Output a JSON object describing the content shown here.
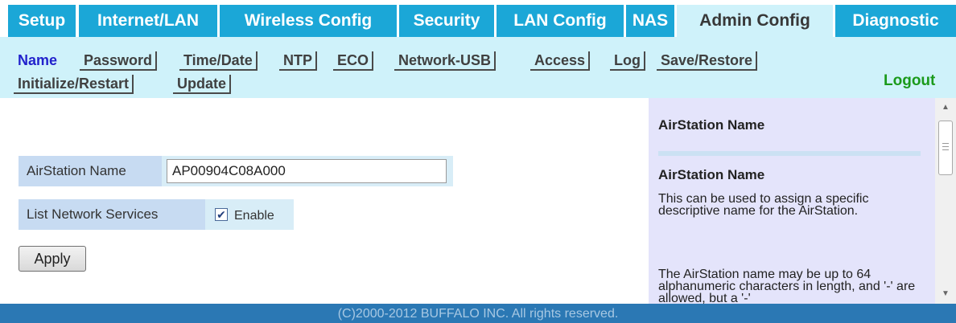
{
  "nav": {
    "tabs": [
      {
        "label": "Setup"
      },
      {
        "label": "Internet/LAN"
      },
      {
        "label": "Wireless Config"
      },
      {
        "label": "Security"
      },
      {
        "label": "LAN Config"
      },
      {
        "label": "NAS"
      },
      {
        "label": "Admin Config",
        "active": true
      },
      {
        "label": "Diagnostic"
      }
    ]
  },
  "subnav": {
    "items": [
      {
        "label": "Name",
        "active": true
      },
      {
        "label": "Password"
      },
      {
        "label": "Time/Date"
      },
      {
        "label": "NTP"
      },
      {
        "label": "ECO"
      },
      {
        "label": "Network-USB"
      },
      {
        "label": "Access"
      },
      {
        "label": "Log"
      },
      {
        "label": "Save/Restore"
      },
      {
        "label": "Initialize/Restart"
      },
      {
        "label": "Update"
      }
    ],
    "logout_label": "Logout"
  },
  "form": {
    "name_label": "AirStation Name",
    "name_value": "AP00904C08A000",
    "services_label": "List Network Services",
    "enable_checked": true,
    "enable_label": "Enable",
    "apply_label": "Apply"
  },
  "help": {
    "title": "AirStation Name",
    "subtitle": "AirStation Name",
    "para1": "This can be used to assign a specific descriptive name for the AirStation.",
    "para2": "The AirStation name may be up to 64 alphanumeric characters in length, and '-' are allowed, but a '-'"
  },
  "footer": {
    "text": "(C)2000-2012 BUFFALO INC. All rights reserved."
  },
  "colors": {
    "tab_bg": "#1ba7d7",
    "active_tab_bg": "#cff2fa",
    "subnav_bg": "#cff2fa",
    "active_subnav_text": "#2222cc",
    "logout_text": "#1b9a1b",
    "help_bg": "#e4e4fb",
    "footer_bg": "#2b78b4"
  }
}
